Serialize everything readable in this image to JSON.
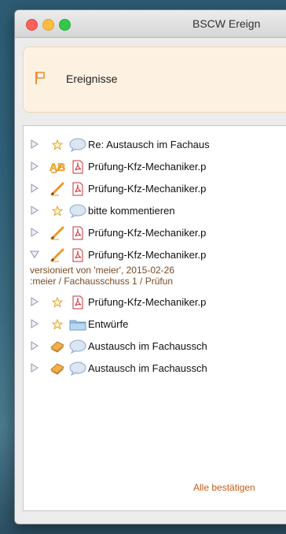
{
  "window": {
    "title": "BSCW Ereign"
  },
  "header": {
    "label": "Ereignisse"
  },
  "colors": {
    "accent": "#c65d1a",
    "header_bg": "#fdf1e2"
  },
  "items": [
    {
      "icon1": "star-icon",
      "icon2": "comment-icon",
      "label": "Re: Austausch im Fachaus"
    },
    {
      "icon1": "ab-spelling-icon",
      "icon2": "pdf-icon",
      "label": "Prüfung-Kfz-Mechaniker.p"
    },
    {
      "icon1": "pencil-icon",
      "icon2": "pdf-icon",
      "label": "Prüfung-Kfz-Mechaniker.p"
    },
    {
      "icon1": "star-icon",
      "icon2": "comment-icon",
      "label": "bitte kommentieren"
    },
    {
      "icon1": "pencil-icon",
      "icon2": "pdf-icon",
      "label": "Prüfung-Kfz-Mechaniker.p"
    },
    {
      "icon1": "pencil-icon",
      "icon2": "pdf-icon",
      "label": "Prüfung-Kfz-Mechaniker.p",
      "expanded": true,
      "details": [
        "versioniert von 'meier', 2015-02-26",
        ":meier / Fachausschuss 1 / Prüfun"
      ]
    },
    {
      "icon1": "star-icon",
      "icon2": "pdf-icon",
      "label": "Prüfung-Kfz-Mechaniker.p"
    },
    {
      "icon1": "star-icon",
      "icon2": "folder-icon",
      "label": "Entwürfe"
    },
    {
      "icon1": "notes-icon",
      "icon2": "comment-icon",
      "label": "Austausch im Fachaussch"
    },
    {
      "icon1": "notes-icon",
      "icon2": "comment-icon",
      "label": "Austausch im Fachaussch"
    }
  ],
  "footer": {
    "confirm_all": "Alle bestätigen"
  }
}
